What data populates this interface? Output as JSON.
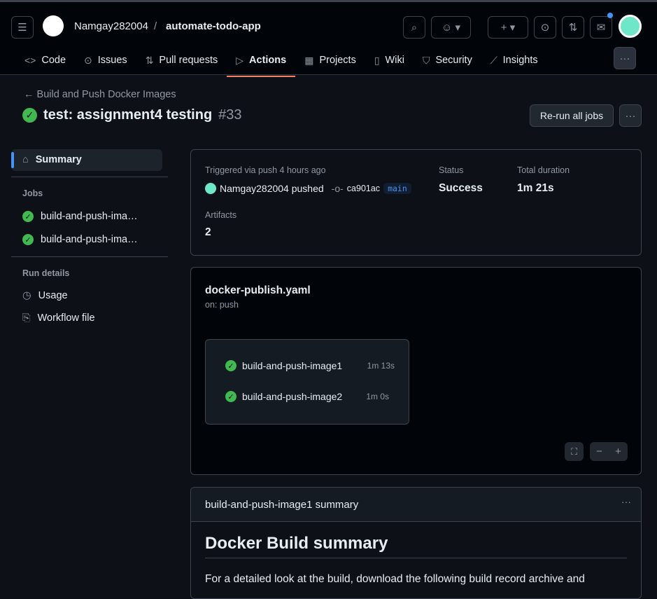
{
  "header": {
    "owner": "Namgay282004",
    "separator": "/",
    "repo": "automate-todo-app"
  },
  "tabs": [
    {
      "label": "Code",
      "icon": "code-icon"
    },
    {
      "label": "Issues",
      "icon": "issue-icon"
    },
    {
      "label": "Pull requests",
      "icon": "pull-request-icon"
    },
    {
      "label": "Actions",
      "icon": "play-icon",
      "active": true
    },
    {
      "label": "Projects",
      "icon": "table-icon"
    },
    {
      "label": "Wiki",
      "icon": "book-icon"
    },
    {
      "label": "Security",
      "icon": "shield-icon"
    },
    {
      "label": "Insights",
      "icon": "graph-icon"
    }
  ],
  "run": {
    "back_label": "Build and Push Docker Images",
    "title": "test: assignment4 testing",
    "number": "#33",
    "rerun_label": "Re-run all jobs"
  },
  "sidebar": {
    "summary": "Summary",
    "jobs_heading": "Jobs",
    "jobs": [
      "build-and-push-ima…",
      "build-and-push-ima…"
    ],
    "details_heading": "Run details",
    "usage": "Usage",
    "workflow_file": "Workflow file"
  },
  "summary": {
    "triggered": "Triggered via push 4 hours ago",
    "actor": "Namgay282004 pushed",
    "commit": "ca901ac",
    "branch": "main",
    "status_label": "Status",
    "status": "Success",
    "duration_label": "Total duration",
    "duration": "1m 21s",
    "artifacts_label": "Artifacts",
    "artifacts": "2"
  },
  "workflow": {
    "file": "docker-publish.yaml",
    "trigger": "on: push",
    "jobs": [
      {
        "name": "build-and-push-image1",
        "time": "1m 13s"
      },
      {
        "name": "build-and-push-image2",
        "time": "1m 0s"
      }
    ]
  },
  "job_summary": {
    "title": "build-and-push-image1 summary",
    "heading": "Docker Build summary",
    "text": "For a detailed look at the build, download the following build record archive and"
  },
  "colors": {
    "success": "#3fb950",
    "accent": "#f78166",
    "background": "#0d1117"
  }
}
